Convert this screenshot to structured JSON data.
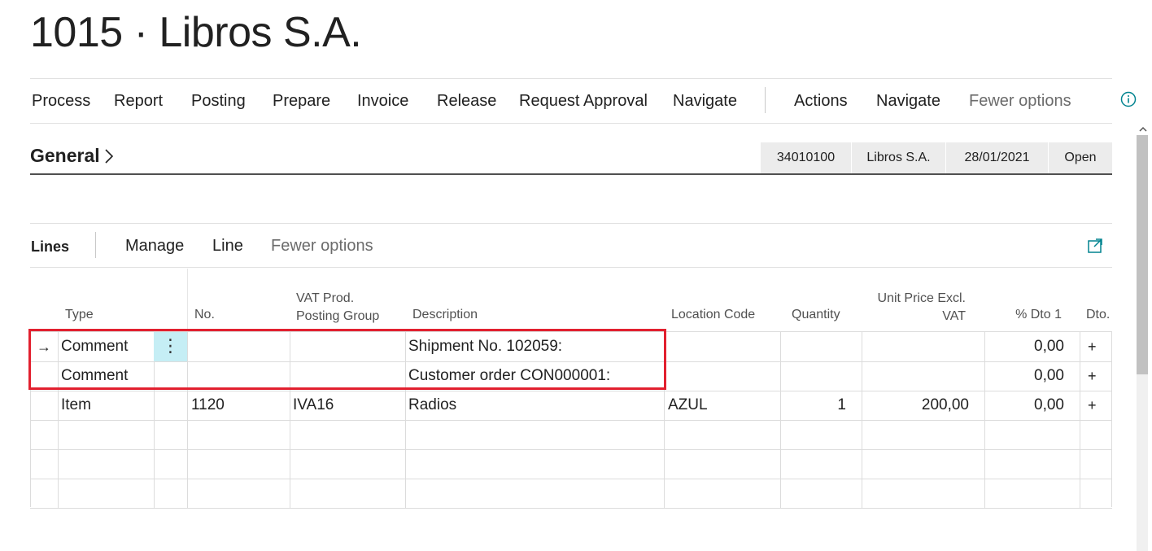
{
  "page": {
    "title": "1015 · Libros S.A."
  },
  "actions": {
    "group1": [
      "Process",
      "Report",
      "Posting",
      "Prepare",
      "Invoice",
      "Release",
      "Request Approval",
      "Navigate"
    ],
    "group2": [
      "Actions",
      "Navigate"
    ],
    "fewer_options": "Fewer options"
  },
  "general": {
    "label": "General",
    "summary": [
      "34010100",
      "Libros S.A.",
      "28/01/2021",
      "Open"
    ]
  },
  "lines": {
    "label": "Lines",
    "actions": [
      "Manage",
      "Line"
    ],
    "fewer_options": "Fewer options",
    "columns": {
      "type": "Type",
      "no": "No.",
      "vat_line1": "VAT Prod.",
      "vat_line2": "Posting Group",
      "description": "Description",
      "location": "Location Code",
      "quantity": "Quantity",
      "unit_price_line1": "Unit Price Excl.",
      "unit_price_line2": "VAT",
      "discount": "% Dto 1",
      "dto": "Dto."
    },
    "rows": [
      {
        "type": "Comment",
        "no": "",
        "vat": "",
        "description": "Shipment No. 102059:",
        "location": "",
        "quantity": "",
        "unit_price": "",
        "discount": "0,00",
        "dto": "+"
      },
      {
        "type": "Comment",
        "no": "",
        "vat": "",
        "description": "Customer order CON000001:",
        "location": "",
        "quantity": "",
        "unit_price": "",
        "discount": "0,00",
        "dto": "+"
      },
      {
        "type": "Item",
        "no": "1120",
        "vat": "IVA16",
        "description": "Radios",
        "location": "AZUL",
        "quantity": "1",
        "unit_price": "200,00",
        "discount": "0,00",
        "dto": "+"
      }
    ],
    "current_row_marker": "→",
    "row_menu_glyph": "⋮"
  },
  "colors": {
    "highlight": "#e2202f",
    "selected_cell": "#c5eef5",
    "accent": "#00838f"
  },
  "icons": {
    "info": "info-icon",
    "expand": "expand-icon"
  }
}
